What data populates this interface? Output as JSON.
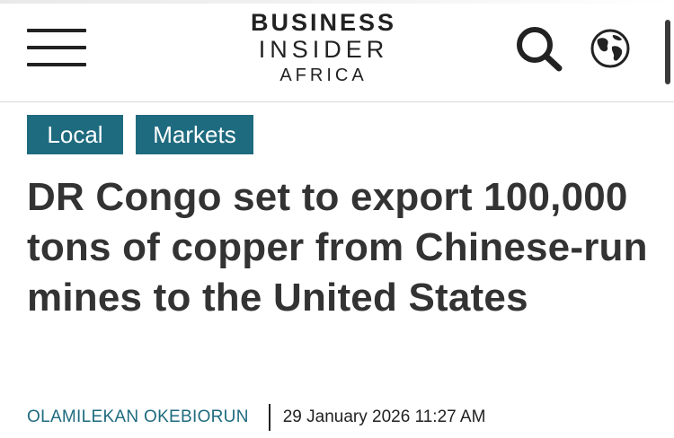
{
  "header": {
    "logo": {
      "line1": "BUSINESS",
      "line2": "INSIDER",
      "line3": "AFRICA"
    },
    "icons": {
      "menu": "hamburger-menu-icon",
      "search": "search-icon",
      "region": "globe-icon"
    }
  },
  "article": {
    "tags": [
      "Local",
      "Markets"
    ],
    "headline": "DR Congo set to export 100,000 tons of copper from Chinese-run mines to the United States",
    "author": "OLAMILEKAN OKEBIORUN",
    "published": "29 January 2026 11:27 AM"
  },
  "colors": {
    "accent": "#1e6b7f",
    "headline": "#333333",
    "icon": "#222222"
  }
}
